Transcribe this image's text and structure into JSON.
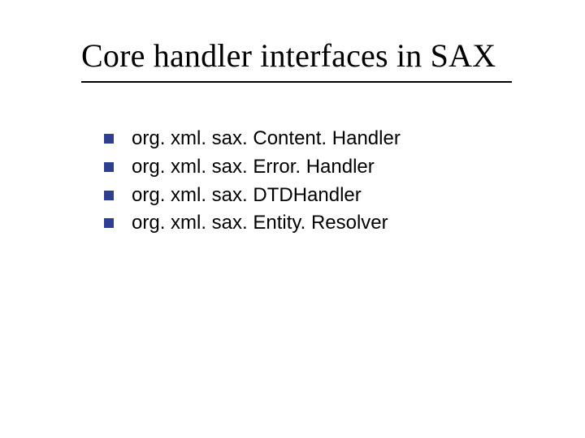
{
  "title": "Core handler interfaces in SAX",
  "bullets": [
    "org. xml. sax. Content. Handler",
    "org. xml. sax. Error. Handler",
    "org. xml. sax. DTDHandler",
    "org. xml. sax. Entity. Resolver"
  ],
  "colors": {
    "bullet": "#2f3e8e"
  }
}
